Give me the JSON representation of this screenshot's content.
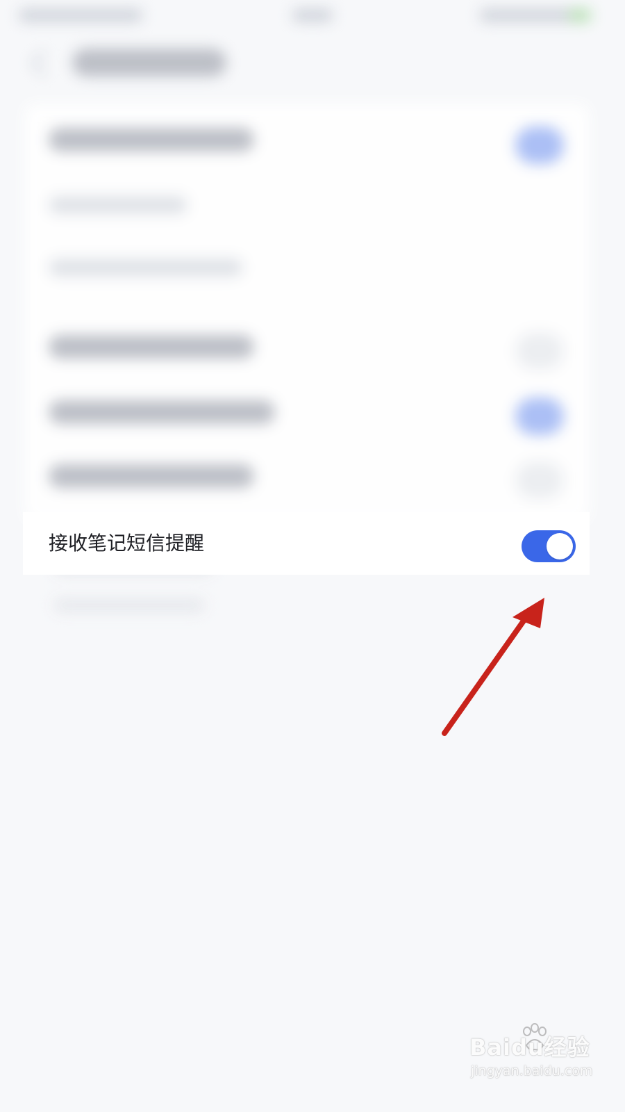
{
  "setting": {
    "label": "接收笔记短信提醒",
    "toggle_on": true,
    "toggle_color": "#3a67e8"
  },
  "annotation": {
    "arrow_color": "#c8231b"
  },
  "watermark": {
    "brand": "Baidu经验",
    "url": "jingyan.baidu.com"
  },
  "icons": {
    "back": "chevron-left-icon",
    "watermark_logo": "paw-icon"
  }
}
